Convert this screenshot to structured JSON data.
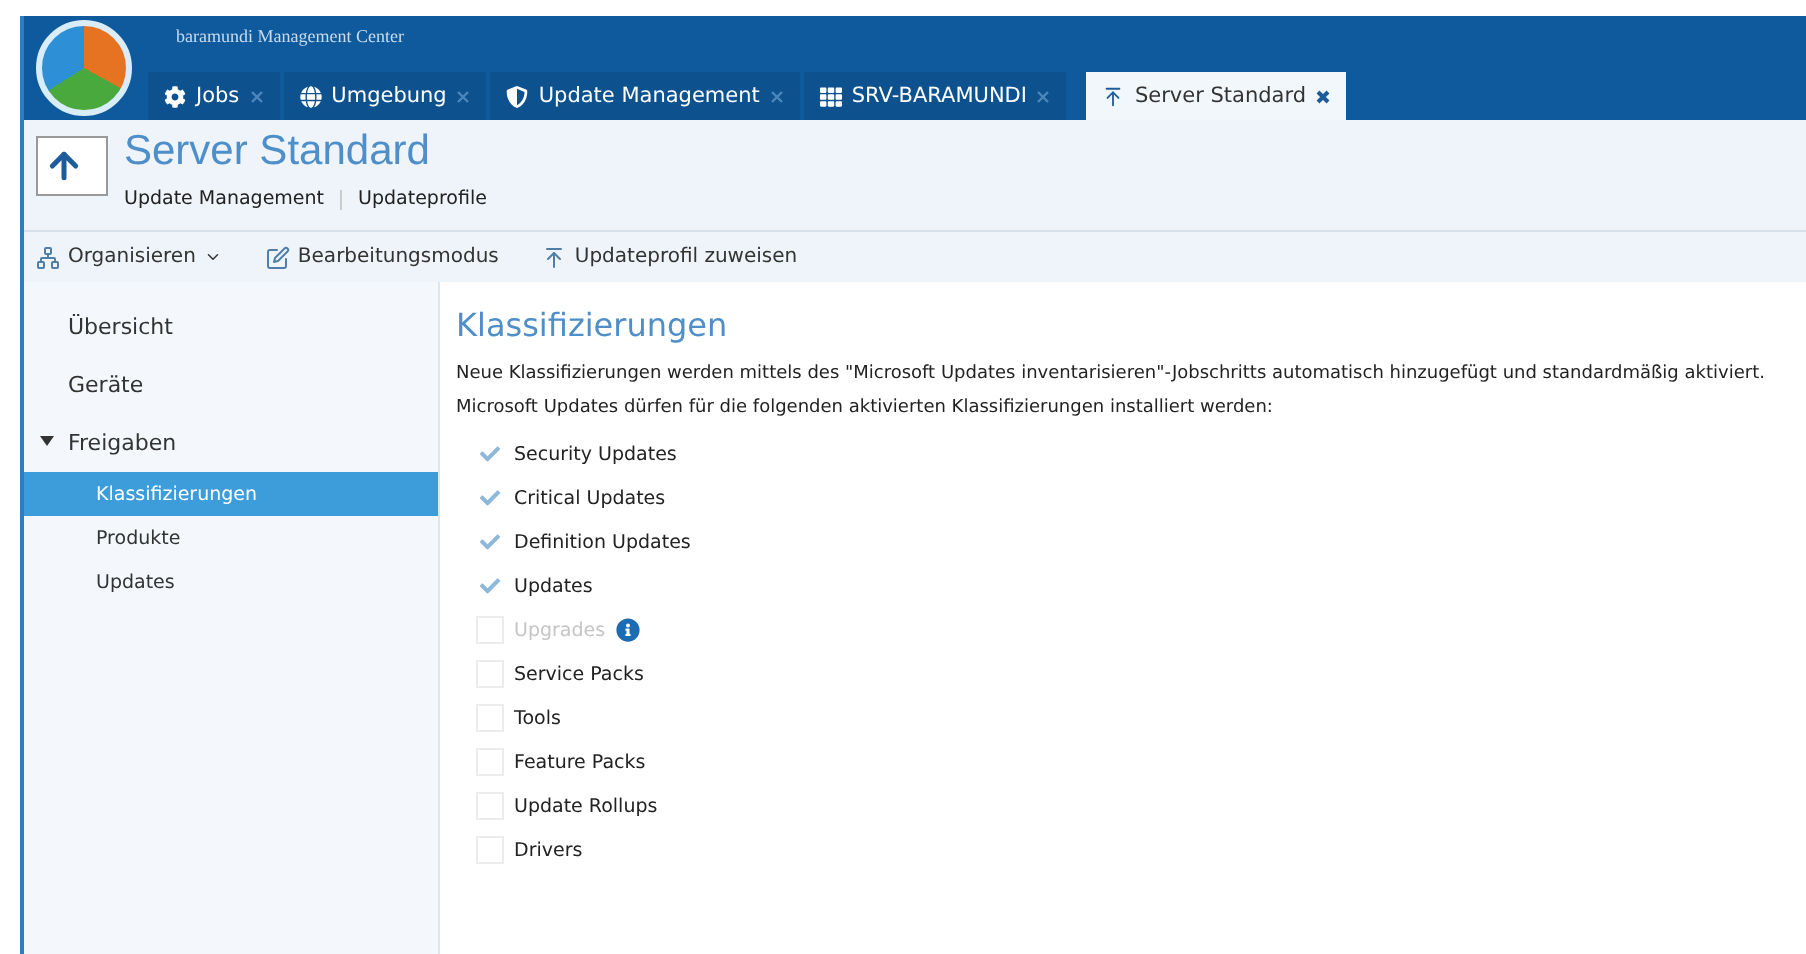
{
  "window": {
    "title": "baramundi Management Center"
  },
  "tabs": [
    {
      "label": "Jobs",
      "selected": false
    },
    {
      "label": "Umgebung",
      "selected": false
    },
    {
      "label": "Update Management",
      "selected": false
    },
    {
      "label": "SRV-BARAMUNDI",
      "selected": false
    },
    {
      "label": "Server Standard",
      "selected": true
    }
  ],
  "header": {
    "title": "Server Standard",
    "breadcrumb": [
      "Update Management",
      "Updateprofile"
    ]
  },
  "toolbar": [
    {
      "label": "Organisieren",
      "dropdown": true
    },
    {
      "label": "Bearbeitungsmodus",
      "dropdown": false
    },
    {
      "label": "Updateprofil zuweisen",
      "dropdown": false
    }
  ],
  "sidebar": {
    "items": [
      {
        "label": "Übersicht",
        "selected": false
      },
      {
        "label": "Geräte",
        "selected": false
      },
      {
        "label": "Freigaben",
        "selected": false,
        "expanded": true,
        "children": [
          {
            "label": "Klassifizierungen",
            "selected": true
          },
          {
            "label": "Produkte",
            "selected": false
          },
          {
            "label": "Updates",
            "selected": false
          }
        ]
      }
    ]
  },
  "content": {
    "title": "Klassifizierungen",
    "paragraphs": [
      "Neue Klassifizierungen werden mittels des \"Microsoft Updates inventarisieren\"-Jobschritts automatisch hinzugefügt und standardmäßig aktiviert.",
      "Microsoft Updates dürfen für die folgenden aktivierten Klassifizierungen installiert werden:"
    ],
    "classifications": [
      {
        "label": "Security Updates",
        "checked": true,
        "disabled": false
      },
      {
        "label": "Critical Updates",
        "checked": true,
        "disabled": false
      },
      {
        "label": "Definition Updates",
        "checked": true,
        "disabled": false
      },
      {
        "label": "Updates",
        "checked": true,
        "disabled": false
      },
      {
        "label": "Upgrades",
        "checked": false,
        "disabled": true,
        "info": true
      },
      {
        "label": "Service Packs",
        "checked": false,
        "disabled": false
      },
      {
        "label": "Tools",
        "checked": false,
        "disabled": false
      },
      {
        "label": "Feature Packs",
        "checked": false,
        "disabled": false
      },
      {
        "label": "Update Rollups",
        "checked": false,
        "disabled": false
      },
      {
        "label": "Drivers",
        "checked": false,
        "disabled": false
      }
    ]
  }
}
